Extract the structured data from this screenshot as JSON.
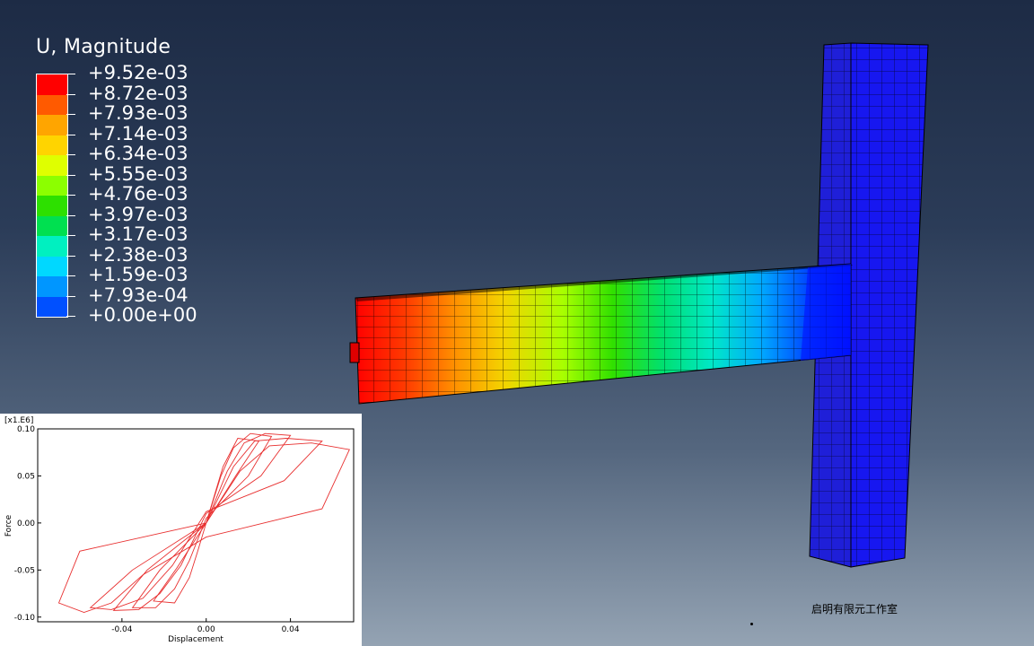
{
  "legend": {
    "title": "U, Magnitude",
    "levels": [
      "+9.52e-03",
      "+8.72e-03",
      "+7.93e-03",
      "+7.14e-03",
      "+6.34e-03",
      "+5.55e-03",
      "+4.76e-03",
      "+3.97e-03",
      "+3.17e-03",
      "+2.38e-03",
      "+1.59e-03",
      "+7.93e-04",
      "+0.00e+00"
    ],
    "colors": [
      "#ff0000",
      "#ff5a00",
      "#ffa500",
      "#ffd400",
      "#dfff00",
      "#8cff00",
      "#2de000",
      "#00e050",
      "#00f0c0",
      "#00d8ff",
      "#0096ff",
      "#0050ff",
      "#0000ff"
    ]
  },
  "plot": {
    "scale_label": "[x1.E6]",
    "xlabel": "Displacement",
    "ylabel": "Force",
    "x_ticks": [
      "-0.04",
      "0.00",
      "0.04"
    ],
    "y_ticks": [
      "0.10",
      "0.05",
      "0.00",
      "-0.05",
      "-0.10"
    ],
    "line_color": "#e83030"
  },
  "chart_data": {
    "type": "line",
    "title": "",
    "xlabel": "Displacement",
    "ylabel": "Force",
    "xlim": [
      -0.08,
      0.07
    ],
    "ylim": [
      -0.105,
      0.1
    ],
    "y_multiplier": "x1.E6",
    "series": [
      {
        "values": [
          [
            0.0,
            0.0
          ],
          [
            0.004,
            0.03
          ],
          [
            0.008,
            0.06
          ],
          [
            0.015,
            0.09
          ],
          [
            0.025,
            0.087
          ],
          [
            0.014,
            0.05
          ],
          [
            0.0,
            0.0
          ],
          [
            -0.004,
            -0.03
          ],
          [
            -0.008,
            -0.058
          ],
          [
            -0.015,
            -0.085
          ],
          [
            -0.025,
            -0.083
          ],
          [
            -0.014,
            -0.048
          ],
          [
            0.0,
            0.0
          ]
        ]
      },
      {
        "values": [
          [
            0.0,
            0.0
          ],
          [
            0.007,
            0.05
          ],
          [
            0.013,
            0.08
          ],
          [
            0.021,
            0.095
          ],
          [
            0.031,
            0.092
          ],
          [
            0.02,
            0.05
          ],
          [
            0.0,
            0.005
          ],
          [
            -0.008,
            -0.04
          ],
          [
            -0.015,
            -0.07
          ],
          [
            -0.024,
            -0.09
          ],
          [
            -0.035,
            -0.09
          ],
          [
            -0.022,
            -0.05
          ],
          [
            0.0,
            0.0
          ]
        ]
      },
      {
        "values": [
          [
            0.0,
            0.0
          ],
          [
            0.01,
            0.055
          ],
          [
            0.018,
            0.085
          ],
          [
            0.028,
            0.095
          ],
          [
            0.04,
            0.093
          ],
          [
            0.026,
            0.05
          ],
          [
            0.0,
            0.01
          ],
          [
            -0.012,
            -0.045
          ],
          [
            -0.022,
            -0.075
          ],
          [
            -0.032,
            -0.092
          ],
          [
            -0.044,
            -0.093
          ],
          [
            -0.028,
            -0.05
          ],
          [
            0.0,
            0.0
          ]
        ]
      },
      {
        "values": [
          [
            0.0,
            0.0
          ],
          [
            0.013,
            0.06
          ],
          [
            0.023,
            0.087
          ],
          [
            0.038,
            0.09
          ],
          [
            0.055,
            0.087
          ],
          [
            0.037,
            0.045
          ],
          [
            0.0,
            0.012
          ],
          [
            -0.016,
            -0.045
          ],
          [
            -0.03,
            -0.08
          ],
          [
            -0.045,
            -0.092
          ],
          [
            -0.055,
            -0.09
          ],
          [
            -0.035,
            -0.05
          ],
          [
            0.0,
            0.0
          ]
        ]
      },
      {
        "values": [
          [
            0.0,
            0.0
          ],
          [
            0.016,
            0.055
          ],
          [
            0.03,
            0.082
          ],
          [
            0.05,
            0.085
          ],
          [
            0.068,
            0.078
          ],
          [
            0.055,
            0.015
          ],
          [
            0.0,
            -0.015
          ],
          [
            -0.03,
            -0.055
          ],
          [
            -0.045,
            -0.085
          ],
          [
            -0.058,
            -0.095
          ],
          [
            -0.07,
            -0.085
          ],
          [
            -0.06,
            -0.03
          ],
          [
            0.0,
            0.0
          ]
        ]
      }
    ]
  },
  "watermark": "启明有限元工作室"
}
